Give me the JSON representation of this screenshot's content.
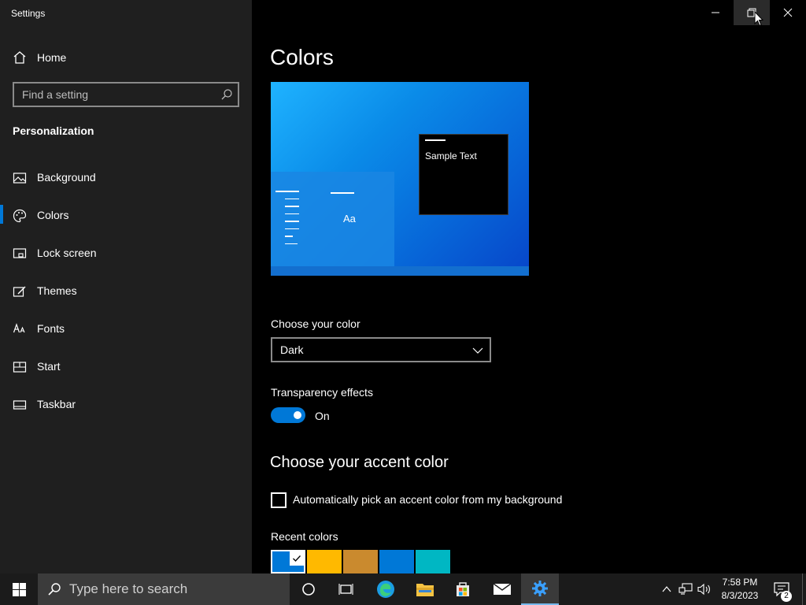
{
  "window": {
    "app_title": "Settings"
  },
  "sidebar": {
    "home_label": "Home",
    "search_placeholder": "Find a setting",
    "section_title": "Personalization",
    "items": [
      {
        "label": "Background",
        "icon": "picture-icon"
      },
      {
        "label": "Colors",
        "icon": "palette-icon",
        "active": true
      },
      {
        "label": "Lock screen",
        "icon": "lock-screen-icon"
      },
      {
        "label": "Themes",
        "icon": "themes-icon"
      },
      {
        "label": "Fonts",
        "icon": "fonts-icon"
      },
      {
        "label": "Start",
        "icon": "start-icon"
      },
      {
        "label": "Taskbar",
        "icon": "taskbar-icon"
      }
    ]
  },
  "main": {
    "page_title": "Colors",
    "preview": {
      "tile_text": "Aa",
      "sample_text": "Sample Text"
    },
    "choose_color_label": "Choose your color",
    "choose_color_value": "Dark",
    "transparency_label": "Transparency effects",
    "transparency_state": "On",
    "accent_title": "Choose your accent color",
    "auto_accent_label": "Automatically pick an accent color from my background",
    "recent_colors_label": "Recent colors",
    "recent_colors": [
      "#0078d7",
      "#ffb900",
      "#ca8a2e",
      "#0078d7",
      "#00b7c3"
    ]
  },
  "taskbar": {
    "search_text": "Type here to search",
    "clock_time": "7:58 PM",
    "clock_date": "8/3/2023",
    "notification_count": "2"
  },
  "colors": {
    "accent": "#0078d7",
    "sidebar_bg": "#1f1f1f",
    "content_bg": "#000000",
    "taskbar_bg": "#1b1b1b"
  }
}
